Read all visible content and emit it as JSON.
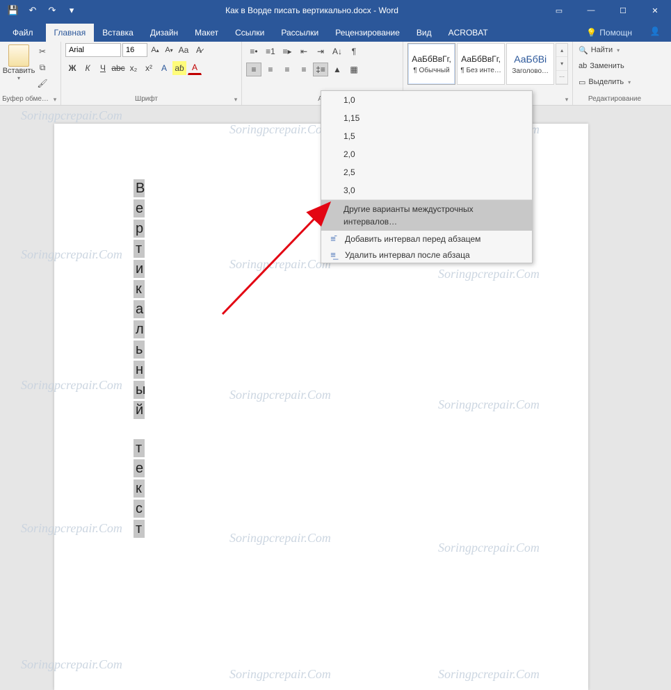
{
  "titlebar": {
    "title": "Как в Ворде писать вертикально.docx - Word",
    "qat": {
      "save": "💾",
      "undo": "↶",
      "redo": "↷",
      "customize": "▾"
    }
  },
  "tabs": {
    "file": "Файл",
    "items": [
      "Главная",
      "Вставка",
      "Дизайн",
      "Макет",
      "Ссылки",
      "Рассылки",
      "Рецензирование",
      "Вид",
      "ACROBAT"
    ],
    "active_index": 0,
    "tell_me": "Помощн",
    "tell_me_icon": "💡"
  },
  "ribbon": {
    "clipboard": {
      "paste": "Вставить",
      "label": "Буфер обме…"
    },
    "font": {
      "name": "Arial",
      "size": "16",
      "grow": "A",
      "shrink": "A",
      "case": "Aa",
      "clear": "A̶",
      "bold": "Ж",
      "italic": "К",
      "underline": "Ч",
      "strike": "abc",
      "sub": "x₂",
      "sup": "x²",
      "effects": "A",
      "highlight": "aɓ",
      "color": "A",
      "label": "Шрифт"
    },
    "paragraph": {
      "label": "Аб"
    },
    "styles": {
      "items": [
        {
          "sample": "АаБбВвГг,",
          "name": "¶ Обычный",
          "blue": false
        },
        {
          "sample": "АаБбВвГг,",
          "name": "¶ Без инте…",
          "blue": false
        },
        {
          "sample": "АаБбВі",
          "name": "Заголово…",
          "blue": true
        }
      ]
    },
    "editing": {
      "find": "Найти",
      "replace": "Заменить",
      "select": "Выделить",
      "label": "Редактирование"
    }
  },
  "line_spacing_menu": {
    "values": [
      "1,0",
      "1,15",
      "1,5",
      "2,0",
      "2,5",
      "3,0"
    ],
    "other": "Другие варианты междустрочных интервалов…",
    "add_before": "Добавить интервал перед абзацем",
    "remove_after": "Удалить интервал после абзаца"
  },
  "document": {
    "word1": "Вертикальный",
    "word2": "текст"
  },
  "watermark": "Soringpcrepair.Com"
}
